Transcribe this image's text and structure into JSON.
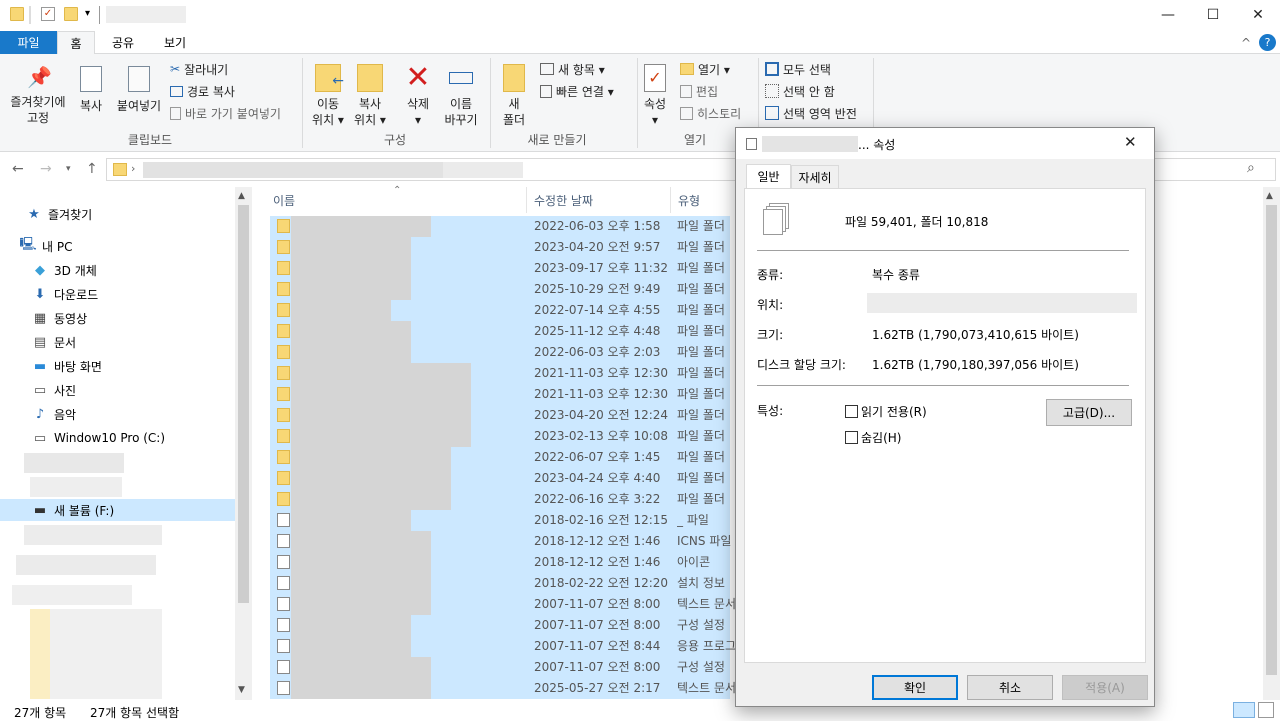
{
  "window": {
    "close_symbol": "✕",
    "min_symbol": "—",
    "max_symbol": "☐"
  },
  "tabs": {
    "file": "파일",
    "home": "홈",
    "share": "공유",
    "view": "보기"
  },
  "ribbon": {
    "pin": "즐겨찾기에\n고정",
    "copy": "복사",
    "paste": "붙여넣기",
    "cut": "잘라내기",
    "copy_path": "경로 복사",
    "paste_shortcut": "바로 가기 붙여넣기",
    "group_clipboard": "클립보드",
    "move_to": "이동\n위치 ▾",
    "copy_to": "복사\n위치 ▾",
    "delete": "삭제\n▾",
    "rename": "이름\n바꾸기",
    "group_organize": "구성",
    "new_folder": "새\n폴더",
    "new_item": "새 항목 ▾",
    "easy_access": "빠른 연결 ▾",
    "group_new": "새로 만들기",
    "properties": "속성\n▾",
    "open": "열기 ▾",
    "edit": "편집",
    "history": "히스토리",
    "group_open": "열기",
    "select_all": "모두 선택",
    "select_none": "선택 안 함",
    "invert_selection": "선택 영역 반전"
  },
  "nav": {
    "quick_access": "즐겨찾기",
    "this_pc": "내 PC",
    "objects3d": "3D 개체",
    "downloads": "다운로드",
    "videos": "동영상",
    "documents": "문서",
    "desktop": "바탕 화면",
    "pictures": "사진",
    "music": "음악",
    "drive_c": "Window10 Pro (C:)",
    "drive_f": "새 볼륨 (F:)"
  },
  "list": {
    "col_name": "이름",
    "col_date": "수정한 날짜",
    "col_type": "유형",
    "rows": [
      {
        "date": "2022-06-03 오후 1:58",
        "type": "파일 폴더"
      },
      {
        "date": "2023-04-20 오전 9:57",
        "type": "파일 폴더"
      },
      {
        "date": "2023-09-17 오후 11:32",
        "type": "파일 폴더"
      },
      {
        "date": "2025-10-29 오전 9:49",
        "type": "파일 폴더"
      },
      {
        "date": "2022-07-14 오후 4:55",
        "type": "파일 폴더"
      },
      {
        "date": "2025-11-12 오후 4:48",
        "type": "파일 폴더"
      },
      {
        "date": "2022-06-03 오후 2:03",
        "type": "파일 폴더"
      },
      {
        "date": "2021-11-03 오후 12:30",
        "type": "파일 폴더"
      },
      {
        "date": "2021-11-03 오후 12:30",
        "type": "파일 폴더"
      },
      {
        "date": "2023-04-20 오전 12:24",
        "type": "파일 폴더"
      },
      {
        "date": "2023-02-13 오후 10:08",
        "type": "파일 폴더"
      },
      {
        "date": "2022-06-07 오후 1:45",
        "type": "파일 폴더"
      },
      {
        "date": "2023-04-24 오후 4:40",
        "type": "파일 폴더"
      },
      {
        "date": "2022-06-16 오후 3:22",
        "type": "파일 폴더"
      },
      {
        "date": "2018-02-16 오전 12:15",
        "type": "_ 파일"
      },
      {
        "date": "2018-12-12 오전 1:46",
        "type": "ICNS 파일"
      },
      {
        "date": "2018-12-12 오전 1:46",
        "type": "아이콘"
      },
      {
        "date": "2018-02-22 오전 12:20",
        "type": "설치 정보"
      },
      {
        "date": "2007-11-07 오전 8:00",
        "type": "텍스트 문서"
      },
      {
        "date": "2007-11-07 오전 8:00",
        "type": "구성 설정"
      },
      {
        "date": "2007-11-07 오전 8:44",
        "type": "응용 프로그램"
      },
      {
        "date": "2007-11-07 오전 8:00",
        "type": "구성 설정"
      },
      {
        "date": "2025-05-27 오전 2:17",
        "type": "텍스트 문서"
      }
    ]
  },
  "status": {
    "count": "27개 항목",
    "selected": "27개 항목 선택함"
  },
  "dialog": {
    "title_suffix": "... 속성",
    "tab_general": "일반",
    "tab_details": "자세히",
    "summary": "파일 59,401, 폴더 10,818",
    "type_label": "종류:",
    "type_value": "복수 종류",
    "location_label": "위치:",
    "size_label": "크기:",
    "size_value": "1.62TB (1,790,073,410,615 바이트)",
    "disk_label": "디스크 할당 크기:",
    "disk_value": "1.62TB (1,790,180,397,056 바이트)",
    "attr_label": "특성:",
    "readonly": "읽기 전용(R)",
    "hidden": "숨김(H)",
    "advanced": "고급(D)...",
    "ok": "확인",
    "cancel": "취소",
    "apply": "적용(A)",
    "close_symbol": "✕"
  }
}
